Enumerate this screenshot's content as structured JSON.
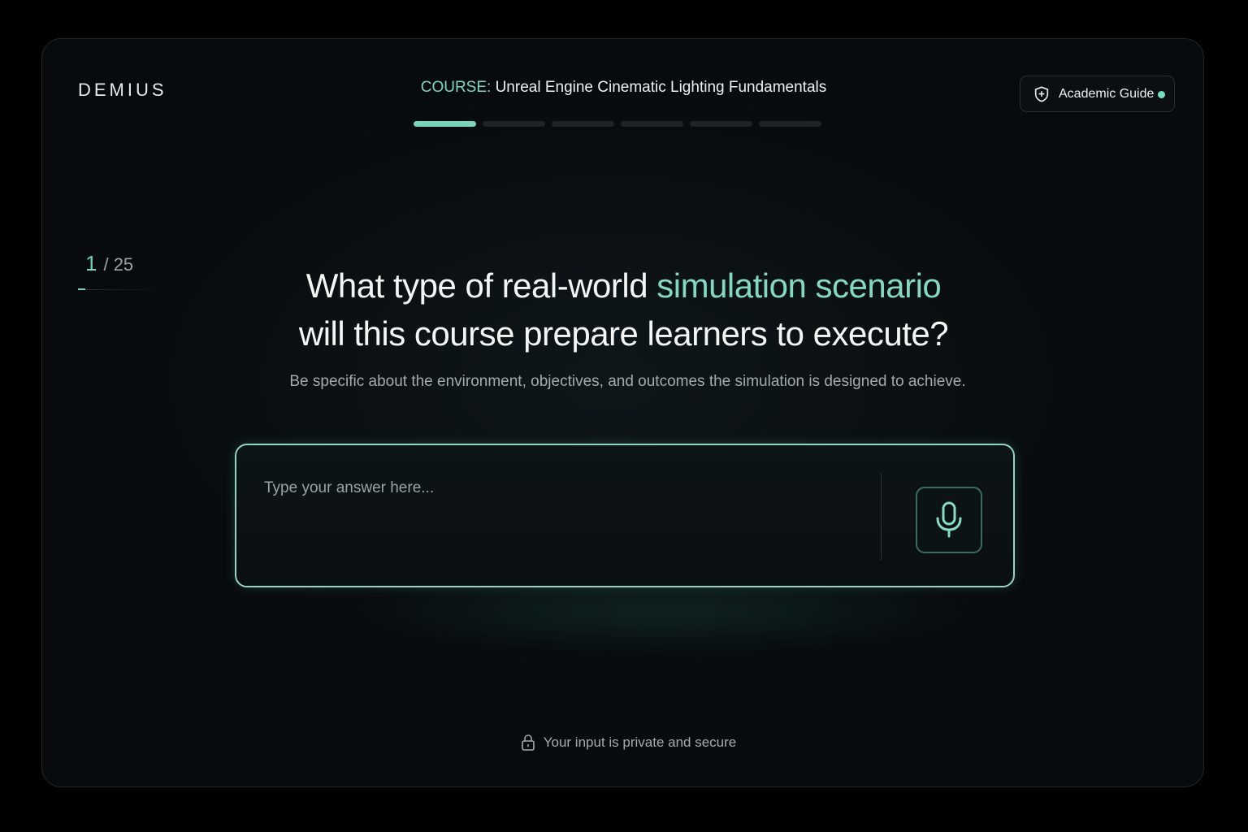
{
  "brand": "DEMIUS",
  "course": {
    "prefix": "COURSE:",
    "title": "Unreal Engine Cinematic Lighting Fundamentals",
    "progress": {
      "total_steps": 6,
      "active_step": 1
    }
  },
  "guide": {
    "label": "Academic Guide",
    "icon": "shield-icon",
    "status_color": "#6fe0c2"
  },
  "counter": {
    "current": "1",
    "total": "/ 25"
  },
  "question": {
    "part1": "What type of real-world ",
    "highlight": "simulation scenario",
    "part2": "will this course prepare learners to execute?"
  },
  "hint": "Be specific about the environment, objectives, and outcomes the simulation is designed to achieve.",
  "answer": {
    "placeholder": "Type your answer here...",
    "value": "",
    "mic_icon": "microphone-icon"
  },
  "footer": {
    "text": "Your input is private and secure",
    "icon": "lock-icon"
  },
  "colors": {
    "accent": "#79d3bd",
    "background": "#080b0d"
  }
}
